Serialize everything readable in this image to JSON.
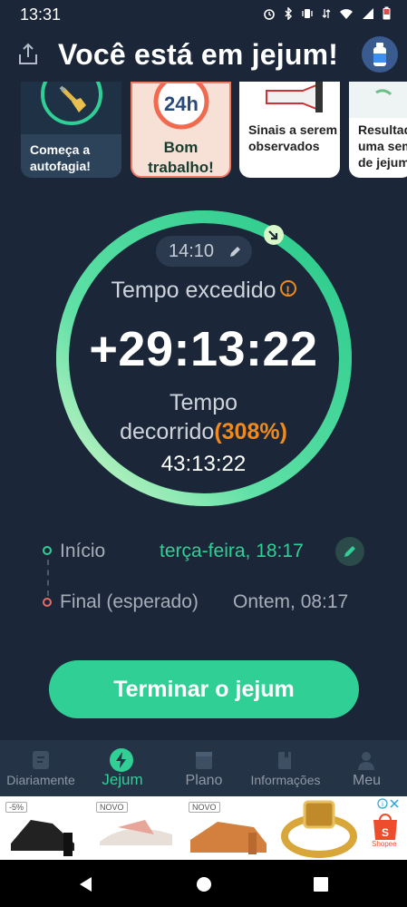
{
  "status_bar": {
    "time": "13:31"
  },
  "header": {
    "title": "Você está em jejum!"
  },
  "cards": [
    {
      "label": "Começa a autofagia!"
    },
    {
      "label": "Bom trabalho!",
      "badge": "24h"
    },
    {
      "label": "Sinais a serem observados"
    },
    {
      "label": "Resultad uma sem de jejum"
    }
  ],
  "timer": {
    "target_chip": "14:10",
    "over_label": "Tempo excedido",
    "over_value": "+29:13:22",
    "elapsed_label_1": "Tempo",
    "elapsed_label_2": "decorrido",
    "elapsed_percent": "(308%)",
    "elapsed_value": "43:13:22",
    "progress_fraction": 1.0
  },
  "schedule": {
    "start_label": "Início",
    "start_value": "terça-feira, 18:17",
    "end_label": "Final (esperado)",
    "end_value": "Ontem, 08:17"
  },
  "cta": {
    "label": "Terminar o jejum"
  },
  "tabs": [
    {
      "label": "Diariamente",
      "icon": "diary-icon",
      "active": false
    },
    {
      "label": "Jejum",
      "icon": "bolt-icon",
      "active": true
    },
    {
      "label": "Plano",
      "icon": "plan-icon",
      "active": false
    },
    {
      "label": "Informações",
      "icon": "book-icon",
      "active": false
    },
    {
      "label": "Meu",
      "icon": "person-icon",
      "active": false
    }
  ],
  "ads": [
    {
      "badge": "-5%"
    },
    {
      "badge": "NOVO"
    },
    {
      "badge": "NOVO"
    },
    {
      "badge": ""
    },
    {
      "badge": "",
      "brand": "Shopee"
    }
  ],
  "colors": {
    "background": "#1b2738",
    "accent_green": "#30cf96",
    "accent_orange": "#f08a1c",
    "tab_active": "#30cf96"
  }
}
